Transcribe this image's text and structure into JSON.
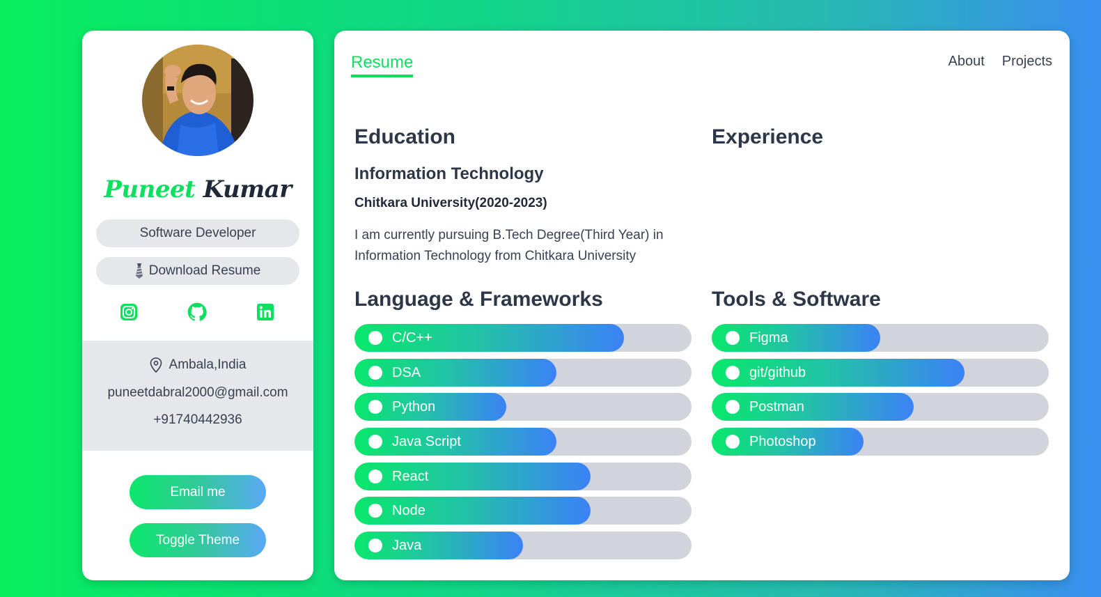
{
  "profile": {
    "first_name": "Puneet",
    "last_name": "Kumar",
    "role": "Software Developer",
    "download_label": "Download Resume",
    "location": "Ambala,India",
    "email": "puneetdabral2000@gmail.com",
    "phone": "+91740442936",
    "email_button": "Email me",
    "theme_button": "Toggle Theme"
  },
  "socials": [
    "instagram-icon",
    "github-icon",
    "linkedin-icon"
  ],
  "nav": {
    "active_tab": "Resume",
    "about": "About",
    "projects": "Projects"
  },
  "education": {
    "heading": "Education",
    "degree": "Information Technology",
    "university": "Chitkara University(2020-2023)",
    "description": "I am currently pursuing B.Tech Degree(Third Year) in Information Technology from Chitkara University"
  },
  "experience": {
    "heading": "Experience"
  },
  "languages": {
    "heading": "Language & Frameworks",
    "items": [
      {
        "label": "C/C++",
        "level": 80
      },
      {
        "label": "DSA",
        "level": 60
      },
      {
        "label": "Python",
        "level": 45
      },
      {
        "label": "Java Script",
        "level": 60
      },
      {
        "label": "React",
        "level": 70
      },
      {
        "label": "Node",
        "level": 70
      },
      {
        "label": "Java",
        "level": 50
      }
    ]
  },
  "tools": {
    "heading": "Tools & Software",
    "items": [
      {
        "label": "Figma",
        "level": 50
      },
      {
        "label": "git/github",
        "level": 75
      },
      {
        "label": "Postman",
        "level": 60
      },
      {
        "label": "Photoshop",
        "level": 45
      }
    ]
  },
  "colors": {
    "accent_green": "#0ce05e",
    "accent_blue": "#3b82f6",
    "pill_gray": "#e5e7eb",
    "bar_track": "#d1d5db"
  }
}
